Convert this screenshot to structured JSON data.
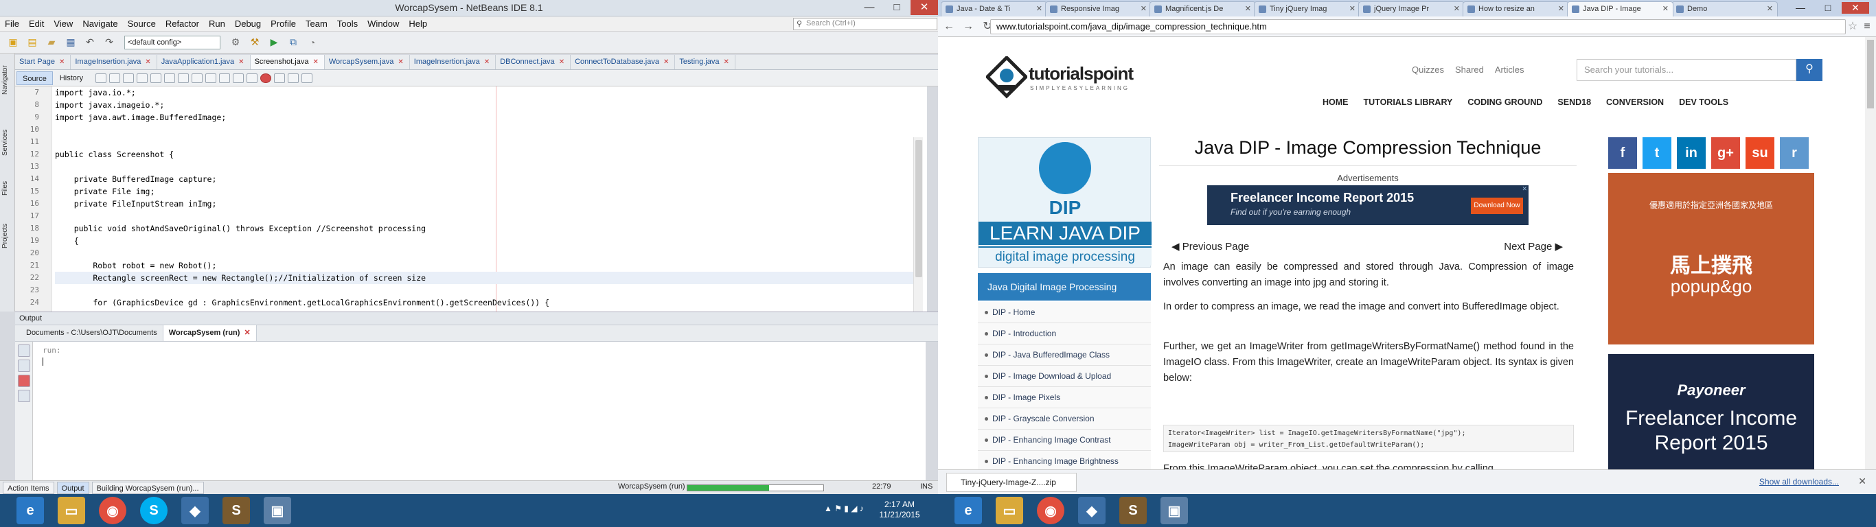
{
  "netbeans": {
    "title": "WorcapSysem - NetBeans IDE 8.1",
    "window_controls": [
      "—",
      "□",
      "✕"
    ],
    "menu": [
      "File",
      "Edit",
      "View",
      "Navigate",
      "Source",
      "Refactor",
      "Run",
      "Debug",
      "Profile",
      "Team",
      "Tools",
      "Window",
      "Help"
    ],
    "search_placeholder": "Search (Ctrl+I)",
    "config": "<default config>",
    "left_panels": [
      "Navigator",
      "Services",
      "Files",
      "Projects"
    ],
    "tabs": [
      {
        "label": "Start Page",
        "active": false
      },
      {
        "label": "ImageInsertion.java",
        "active": false
      },
      {
        "label": "JavaApplication1.java",
        "active": false
      },
      {
        "label": "Screenshot.java",
        "active": true
      },
      {
        "label": "WorcapSysem.java",
        "active": false
      },
      {
        "label": "ImageInsertion.java",
        "active": false
      },
      {
        "label": "DBConnect.java",
        "active": false
      },
      {
        "label": "ConnectToDatabase.java",
        "active": false
      },
      {
        "label": "Testing.java",
        "active": false
      }
    ],
    "source_tab": "Source",
    "history_tab": "History",
    "code_lines": [
      {
        "n": "7",
        "text": "import java.io.*;"
      },
      {
        "n": "8",
        "text": "import javax.imageio.*;"
      },
      {
        "n": "9",
        "text": "import java.awt.image.BufferedImage;"
      },
      {
        "n": "10",
        "text": ""
      },
      {
        "n": "11",
        "text": ""
      },
      {
        "n": "12",
        "text": "public class Screenshot {"
      },
      {
        "n": "13",
        "text": ""
      },
      {
        "n": "14",
        "text": "    private BufferedImage capture;"
      },
      {
        "n": "15",
        "text": "    private File img;"
      },
      {
        "n": "16",
        "text": "    private FileInputStream inImg;"
      },
      {
        "n": "17",
        "text": ""
      },
      {
        "n": "18",
        "text": "    public void shotAndSaveOriginal() throws Exception //Screenshot processing"
      },
      {
        "n": "19",
        "text": "    {"
      },
      {
        "n": "20",
        "text": ""
      },
      {
        "n": "21",
        "text": "        Robot robot = new Robot();"
      },
      {
        "n": "22",
        "text": "        Rectangle screenRect = new Rectangle();//Initialization of screen size"
      },
      {
        "n": "23",
        "text": ""
      },
      {
        "n": "24",
        "text": "        for (GraphicsDevice gd : GraphicsEnvironment.getLocalGraphicsEnvironment().getScreenDevices()) {"
      }
    ],
    "output_title": "Output",
    "output_tabs": [
      {
        "label": "Documents - C:\\Users\\OJT\\Documents",
        "active": false
      },
      {
        "label": "WorcapSysem (run)",
        "active": true
      }
    ],
    "output_text": "run:",
    "status": {
      "action_items": "Action Items",
      "output": "Output",
      "building": "Building WorcapSysem (run)...",
      "run_label": "WorcapSysem (run)",
      "progress": 0.6,
      "position": "22:79",
      "mode": "INS"
    }
  },
  "chrome": {
    "tabs": [
      {
        "label": "Java - Date & Ti",
        "active": false
      },
      {
        "label": "Responsive Imag",
        "active": false
      },
      {
        "label": "Magnificent.js De",
        "active": false
      },
      {
        "label": "Tiny jQuery Imag",
        "active": false
      },
      {
        "label": "jQuery Image Pr",
        "active": false
      },
      {
        "label": "How to resize an",
        "active": false
      },
      {
        "label": "Java DIP - Image",
        "active": true
      },
      {
        "label": "Demo",
        "active": false
      }
    ],
    "url": "www.tutorialspoint.com/java_dip/image_compression_technique.htm",
    "top_links": [
      "Quizzes",
      "Shared",
      "Articles"
    ],
    "search_placeholder": "Search your tutorials...",
    "logo_text": "tutorialspoint",
    "logo_tagline": "SIMPLYEASYLEARNING",
    "nav": [
      "HOME",
      "TUTORIALS LIBRARY",
      "CODING GROUND",
      "SEND18",
      "CONVERSION",
      "DEV TOOLS"
    ],
    "banner": {
      "title": "DIP",
      "learn": "LEARN JAVA DIP",
      "sub": "digital image processing"
    },
    "menu_head": "Java Digital Image Processing",
    "menu": [
      "DIP - Home",
      "DIP - Introduction",
      "DIP - Java BufferedImage Class",
      "DIP - Image Download & Upload",
      "DIP - Image Pixels",
      "DIP - Grayscale Conversion",
      "DIP - Enhancing Image Contrast",
      "DIP - Enhancing Image Brightness"
    ],
    "page_title": "Java DIP - Image Compression Technique",
    "ads_label": "Advertisements",
    "ad": {
      "headline": "Freelancer Income Report 2015",
      "sub": "Find out if you're earning enough",
      "button": "Download Now"
    },
    "prev": "Previous Page",
    "next": "Next Page",
    "paragraphs": [
      "An image can easily be compressed and stored through Java. Compression of image involves converting an image into jpg and storing it.",
      "In order to compress an image, we read the image and convert into BufferedImage object.",
      "Further, we get an ImageWriter from getImageWritersByFormatName() method found in the ImageIO class. From this ImageWriter, create an ImageWriteParam object. Its syntax is given below:"
    ],
    "code": "Iterator<ImageWriter> list = ImageIO.getImageWritersByFormatName(\"jpg\");\nImageWriteParam obj = writer_From_List.getDefaultWriteParam();",
    "cut_text": "From this ImageWriteParam object, you can set the compression by calling",
    "social": [
      "f",
      "t",
      "in",
      "g+",
      "su",
      "r"
    ],
    "ad2": {
      "line1": "優惠適用於指定亞洲各國家及地區",
      "line2": "",
      "brand": "馬上撲飛",
      "cta": "popup&go"
    },
    "ad3": {
      "brand": "Payoneer",
      "headline": "Freelancer Income Report 2015"
    },
    "download": {
      "file": "Tiny-jQuery-Image-Z....zip",
      "show_all": "Show all downloads...",
      "close": "✕"
    }
  },
  "taskbar": {
    "time": "2:17 AM",
    "date": "11/21/2015"
  },
  "colors": {
    "accent": "#2f6fb7",
    "taskbar": "#1d4f7c",
    "tp_blue": "#1b77ad"
  }
}
